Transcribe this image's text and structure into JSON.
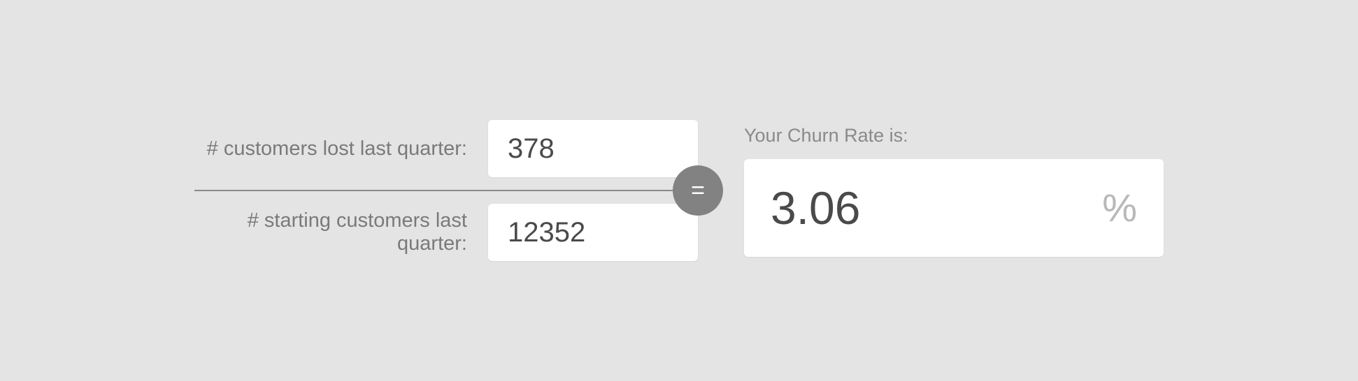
{
  "inputs": {
    "customers_lost": {
      "label": "# customers lost last quarter:",
      "value": "378"
    },
    "starting_customers": {
      "label": "# starting customers last quarter:",
      "value": "12352"
    }
  },
  "equals_symbol": "=",
  "result": {
    "label": "Your Churn Rate is:",
    "value": "3.06",
    "unit": "%"
  }
}
